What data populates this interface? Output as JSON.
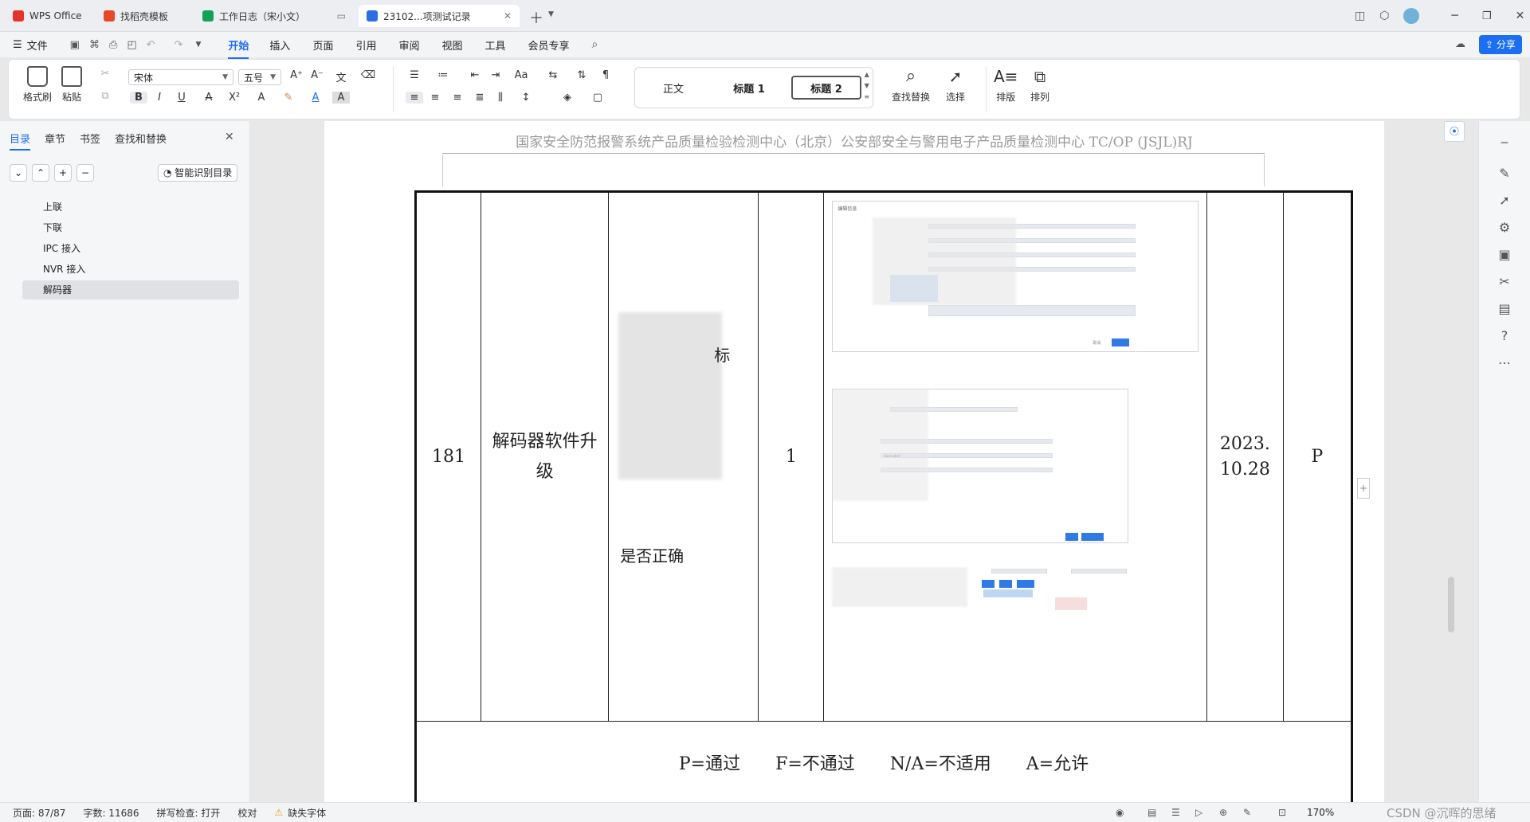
{
  "tabs": [
    {
      "label": "WPS Office",
      "color": "#e5322d"
    },
    {
      "label": "找稻壳模板",
      "color": "#e8472b"
    },
    {
      "label": "工作日志（宋小文）",
      "color": "#15a05a"
    },
    {
      "label": "23102...项测试记录",
      "color": "#2b6de3"
    }
  ],
  "menu": {
    "file": "文件",
    "items": [
      "开始",
      "插入",
      "页面",
      "引用",
      "审阅",
      "视图",
      "工具",
      "会员专享"
    ],
    "active": "开始",
    "share": "分享"
  },
  "ribbon": {
    "format_painter": "格式刷",
    "paste": "粘贴",
    "font_name": "宋体",
    "font_size": "五号",
    "styles": [
      "正文",
      "标题 1",
      "标题 2"
    ],
    "find_replace": "查找替换",
    "select": "选择",
    "layout": "排版",
    "arrange": "排列"
  },
  "sidebar": {
    "tabs": [
      "目录",
      "章节",
      "书签",
      "查找和替换"
    ],
    "smart_toc": "智能识别目录",
    "items": [
      "上联",
      "下联",
      "IPC 接入",
      "NVR 接入",
      "解码器"
    ],
    "selected": "解码器"
  },
  "document": {
    "header": "国家安全防范报警系统产品质量检验检测中心（北京）公安部安全与警用电子产品质量检测中心 TC/OP (JSJL)RJ",
    "row": {
      "no": "181",
      "item": "解码器软件升级",
      "method_fragment_1": "标",
      "method_fragment_2": "是否正确",
      "count": "1",
      "date": "2023.\n10.28",
      "result": "P"
    },
    "footer_legend": "P=通过　　F=不通过　　N/A=不适用　　A=允许",
    "shot": {
      "dialog_title": "编辑信息",
      "field_value": "decoder",
      "cancel": "取消",
      "confirm": "确定",
      "upgrade": "升级"
    }
  },
  "status": {
    "page": "页面: 87/87",
    "words": "字数: 11686",
    "spell": "拼写检查: 打开",
    "proof": "校对",
    "missing_font": "缺失字体",
    "zoom": "170%",
    "watermark": "CSDN @沉晖的思绪"
  }
}
